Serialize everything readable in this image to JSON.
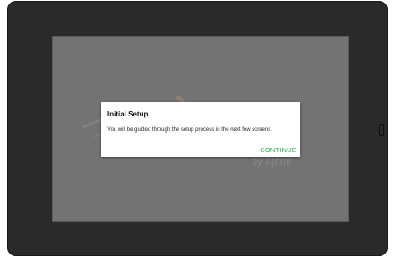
{
  "splash": {
    "byline": "by Ajone"
  },
  "dialog": {
    "title": "Initial Setup",
    "message": "You will be guided through the setup process in the next few screens.",
    "button_label": "CONTINUE"
  },
  "colors": {
    "bezel": "#2a2a2a",
    "screen_dim": "#737373",
    "dialog_bg": "#ffffff",
    "accent_button": "#2bb14c",
    "logo_swoosh": "#9e7f74"
  }
}
